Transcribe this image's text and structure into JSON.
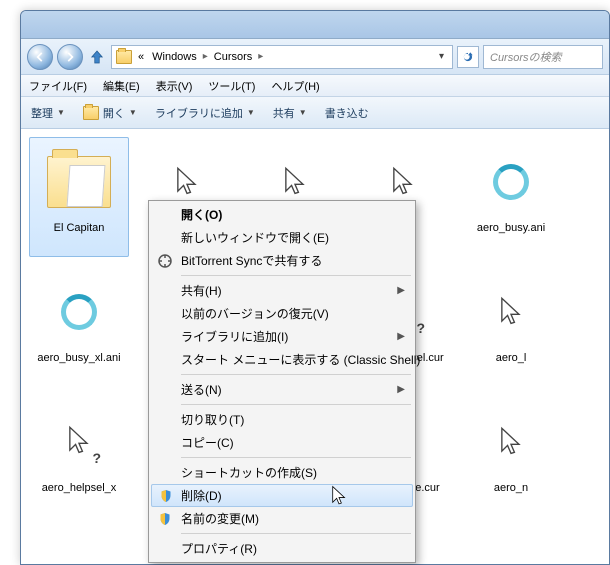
{
  "address": {
    "prefix": "«",
    "crumbs": [
      "Windows",
      "Cursors"
    ],
    "sep": "▸"
  },
  "search_placeholder": "Cursorsの検索",
  "menubar": [
    "ファイル(F)",
    "編集(E)",
    "表示(V)",
    "ツール(T)",
    "ヘルプ(H)"
  ],
  "toolbar": {
    "organize": "整理",
    "open": "開く",
    "addlib": "ライブラリに追加",
    "share": "共有",
    "write": "書き込む"
  },
  "items": [
    {
      "label": "El Capitan",
      "kind": "folder",
      "selected": true
    },
    {
      "label": "",
      "kind": "arrow"
    },
    {
      "label": "",
      "kind": "arrow"
    },
    {
      "label": "",
      "kind": "arrow"
    },
    {
      "label": "aero_busy.ani",
      "kind": "busy"
    },
    {
      "label": "aero_busy_xl.ani",
      "kind": "busy"
    },
    {
      "label": "",
      "kind": "arrow"
    },
    {
      "label": "",
      "kind": "arrow"
    },
    {
      "label": "aero_helpsel.cur",
      "kind": "help"
    },
    {
      "label": "aero_l",
      "kind": "arrow"
    },
    {
      "label": "aero_helpsel_x",
      "kind": "help"
    },
    {
      "label": "",
      "kind": "blank"
    },
    {
      "label": "",
      "kind": "blank"
    },
    {
      "label": "aero_move.cur",
      "kind": "move"
    },
    {
      "label": "aero_n",
      "kind": "arrow"
    }
  ],
  "ctx": {
    "open": "開く(O)",
    "newwin": "新しいウィンドウで開く(E)",
    "btsync": "BitTorrent Syncで共有する",
    "share": "共有(H)",
    "restore": "以前のバージョンの復元(V)",
    "addlib": "ライブラリに追加(I)",
    "startmenu": "スタート メニューに表示する (Classic Shell)",
    "send": "送る(N)",
    "cut": "切り取り(T)",
    "copy": "コピー(C)",
    "shortcut": "ショートカットの作成(S)",
    "delete": "削除(D)",
    "rename": "名前の変更(M)",
    "props": "プロパティ(R)"
  }
}
